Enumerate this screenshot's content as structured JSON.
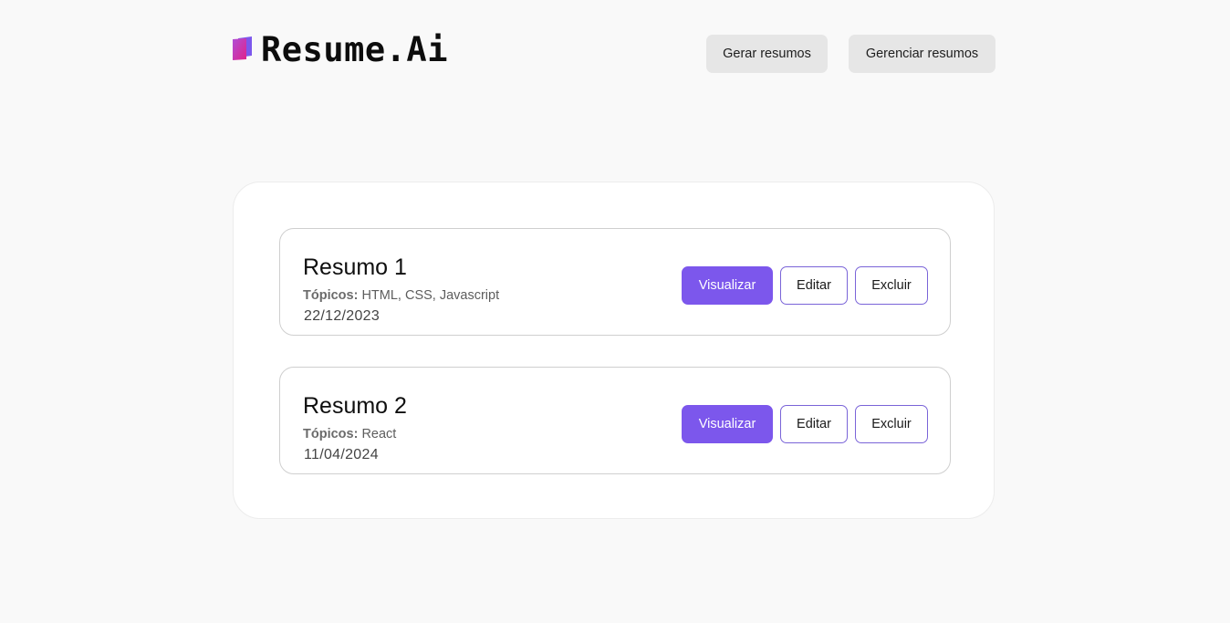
{
  "header": {
    "logo_text": "Resume.Ai",
    "nav": {
      "gerar_label": "Gerar resumos",
      "gerenciar_label": "Gerenciar resumos"
    }
  },
  "summaries": [
    {
      "title": "Resumo 1",
      "topics_label": "Tópicos:",
      "topics": "HTML, CSS, Javascript",
      "date": "22/12/2023",
      "actions": {
        "view": "Visualizar",
        "edit": "Editar",
        "delete": "Excluir"
      }
    },
    {
      "title": "Resumo 2",
      "topics_label": "Tópicos:",
      "topics": "React",
      "date": "11/04/2024",
      "actions": {
        "view": "Visualizar",
        "edit": "Editar",
        "delete": "Excluir"
      }
    }
  ],
  "colors": {
    "accent": "#7c57ec",
    "logo_gradient_start": "#7c57ec",
    "logo_gradient_end": "#e0218a",
    "nav_button_bg": "#e6e6e6",
    "page_bg": "#f9f9f9"
  },
  "icons": {
    "logo": "book-icon"
  }
}
